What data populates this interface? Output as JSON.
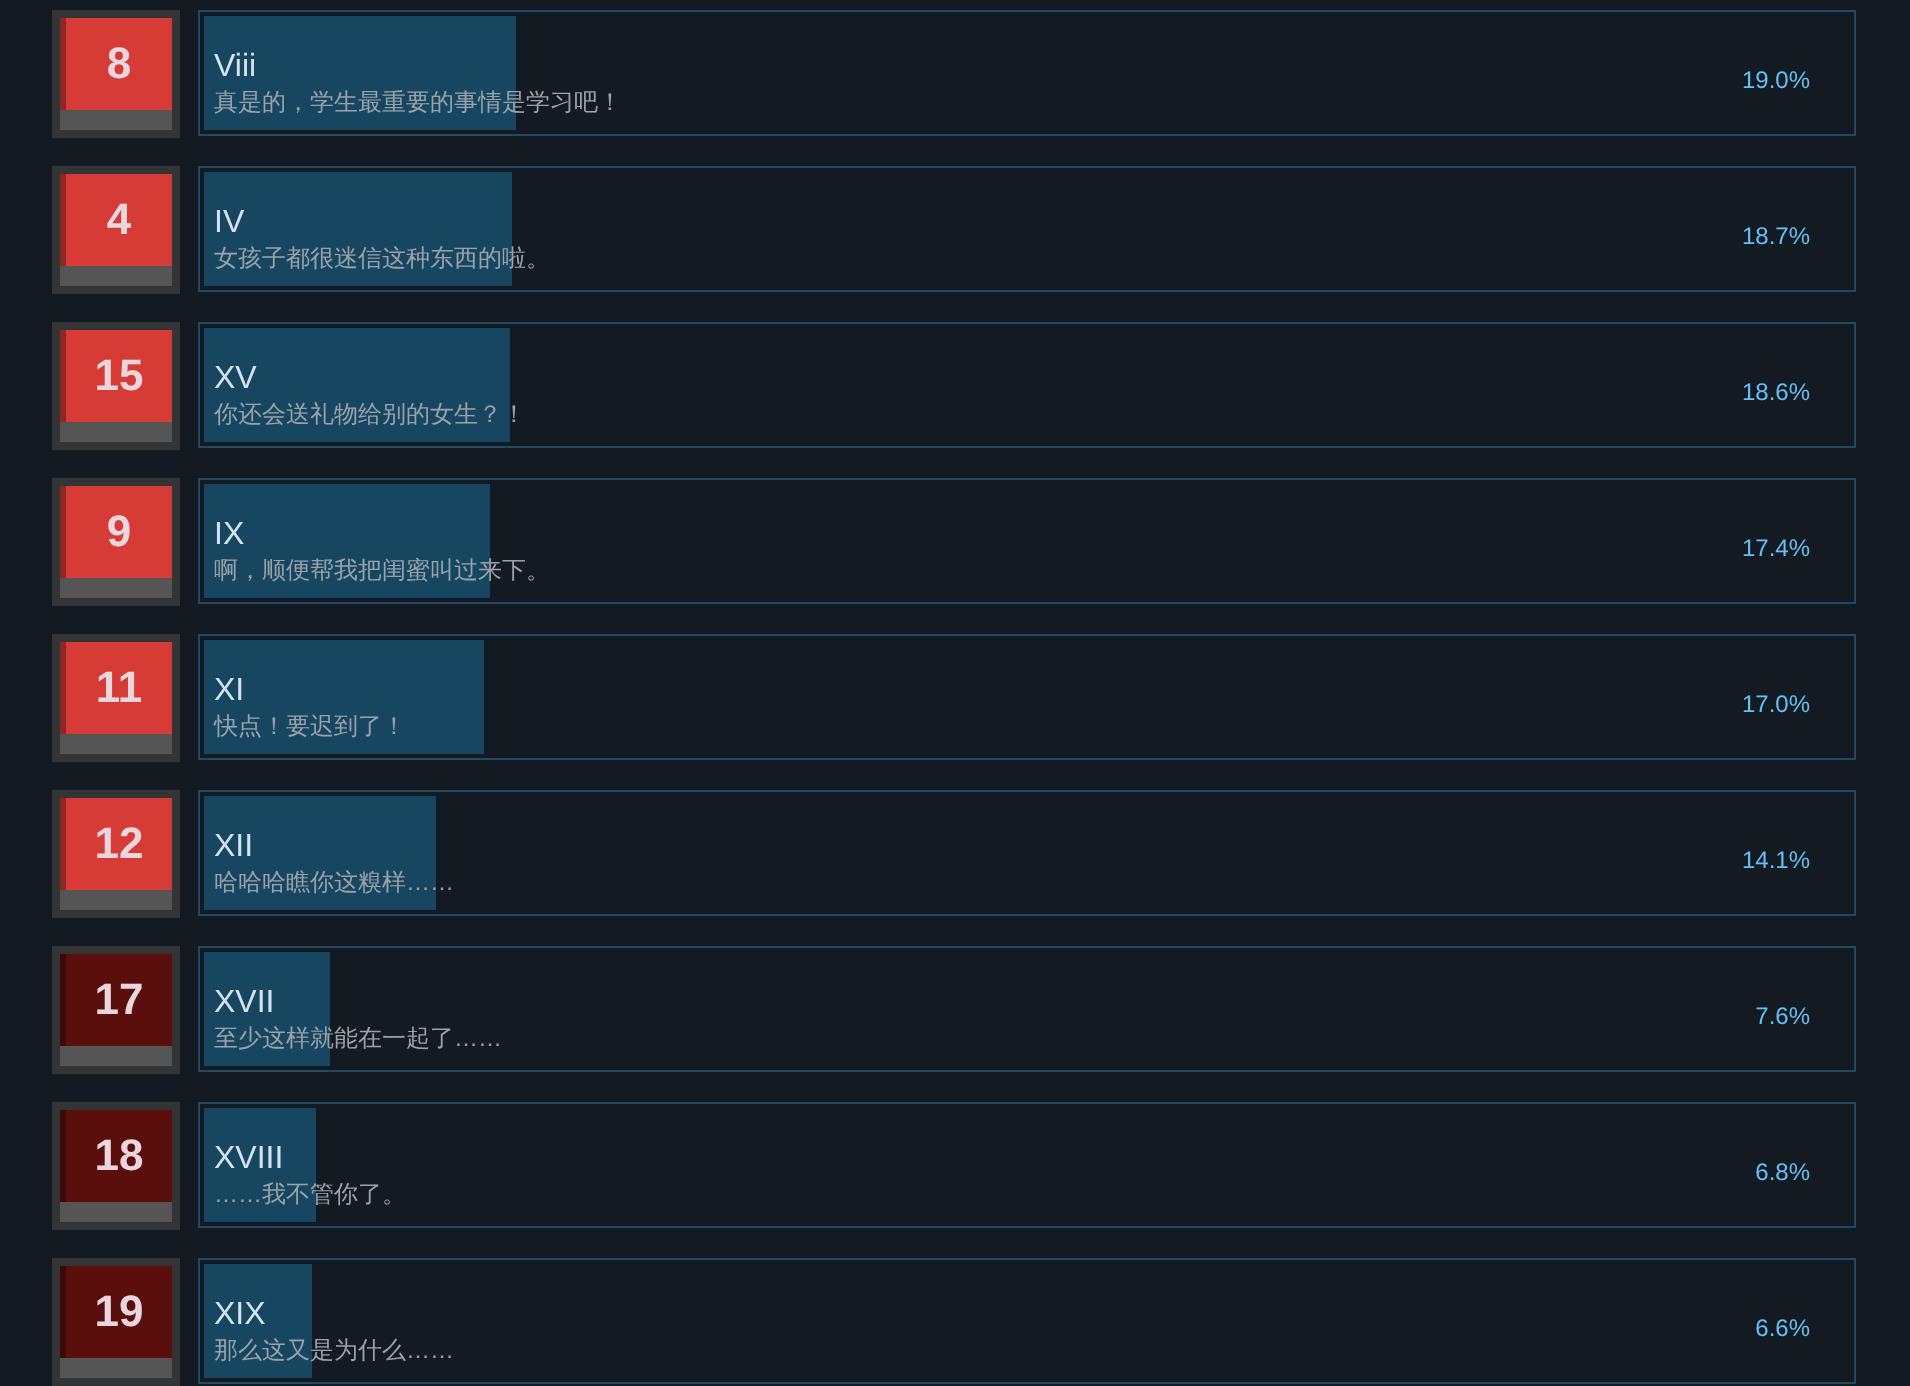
{
  "achievements": [
    {
      "badge": "8",
      "color": "#d63c35",
      "title": "Viii",
      "description": "真是的，学生最重要的事情是学习吧！",
      "level": 0.19,
      "percent": "19.0%"
    },
    {
      "badge": "4",
      "color": "#d63c35",
      "title": "IV",
      "description": "女孩子都很迷信这种东西的啦。",
      "level": 0.187,
      "percent": "18.7%"
    },
    {
      "badge": "15",
      "color": "#d63c35",
      "title": "XV",
      "description": "你还会送礼物给别的女生？！",
      "level": 0.186,
      "percent": "18.6%"
    },
    {
      "badge": "9",
      "color": "#d63c35",
      "title": "IX",
      "description": "啊，顺便帮我把闺蜜叫过来下。",
      "level": 0.174,
      "percent": "17.4%"
    },
    {
      "badge": "11",
      "color": "#d63c35",
      "title": "XI",
      "description": "快点！要迟到了！",
      "level": 0.17,
      "percent": "17.0%"
    },
    {
      "badge": "12",
      "color": "#d63c35",
      "title": "XII",
      "description": "哈哈哈瞧你这糗样……",
      "level": 0.141,
      "percent": "14.1%"
    },
    {
      "badge": "17",
      "color": "#5a0f0c",
      "title": "XVII",
      "description": "至少这样就能在一起了……",
      "level": 0.076,
      "percent": "7.6%"
    },
    {
      "badge": "18",
      "color": "#5a0f0c",
      "title": "XVIII",
      "description": "……我不管你了。",
      "level": 0.068,
      "percent": "6.8%"
    },
    {
      "badge": "19",
      "color": "#5a0f0c",
      "title": "XIX",
      "description": "那么这又是为什么……",
      "level": 0.066,
      "percent": "6.6%"
    }
  ]
}
